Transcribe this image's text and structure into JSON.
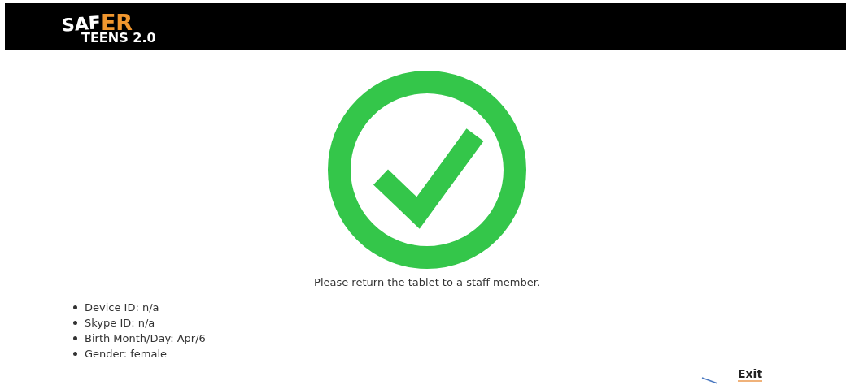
{
  "header": {
    "logo": {
      "part_1": "SAF",
      "part_2": "ER",
      "part_3": "TEENS 2.0"
    }
  },
  "message": "Please return the tablet to a staff member.",
  "details": [
    "Device ID: n/a",
    "Skype ID: n/a",
    "Birth Month/Day: Apr/6",
    "Gender: female"
  ],
  "exit_link": "Exit"
}
